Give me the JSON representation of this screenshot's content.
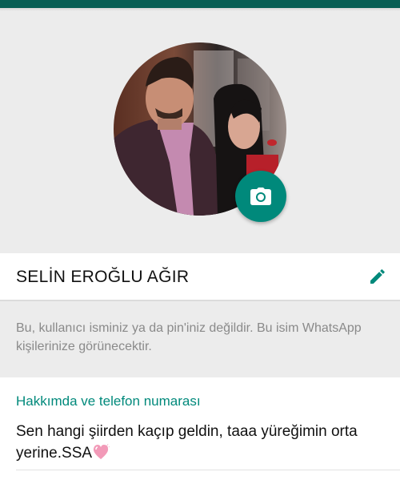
{
  "profile": {
    "name": "SELİN EROĞLU AĞIR",
    "name_hint": "Bu, kullanıcı isminiz ya da pin'iniz değildir. Bu isim WhatsApp kişilerinize görünecektir.",
    "avatar_icon": "profile-photo",
    "camera_icon": "camera-icon",
    "edit_icon": "pencil-icon"
  },
  "about": {
    "heading": "Hakkımda ve telefon numarası",
    "status": "Sen hangi şiirden kaçıp geldin, taaa yüreğimin orta yerine.SSA",
    "emoji_icon": "sparkling-heart-icon"
  },
  "colors": {
    "accent": "#00897b",
    "header": "#075e54",
    "background": "#ececec"
  }
}
